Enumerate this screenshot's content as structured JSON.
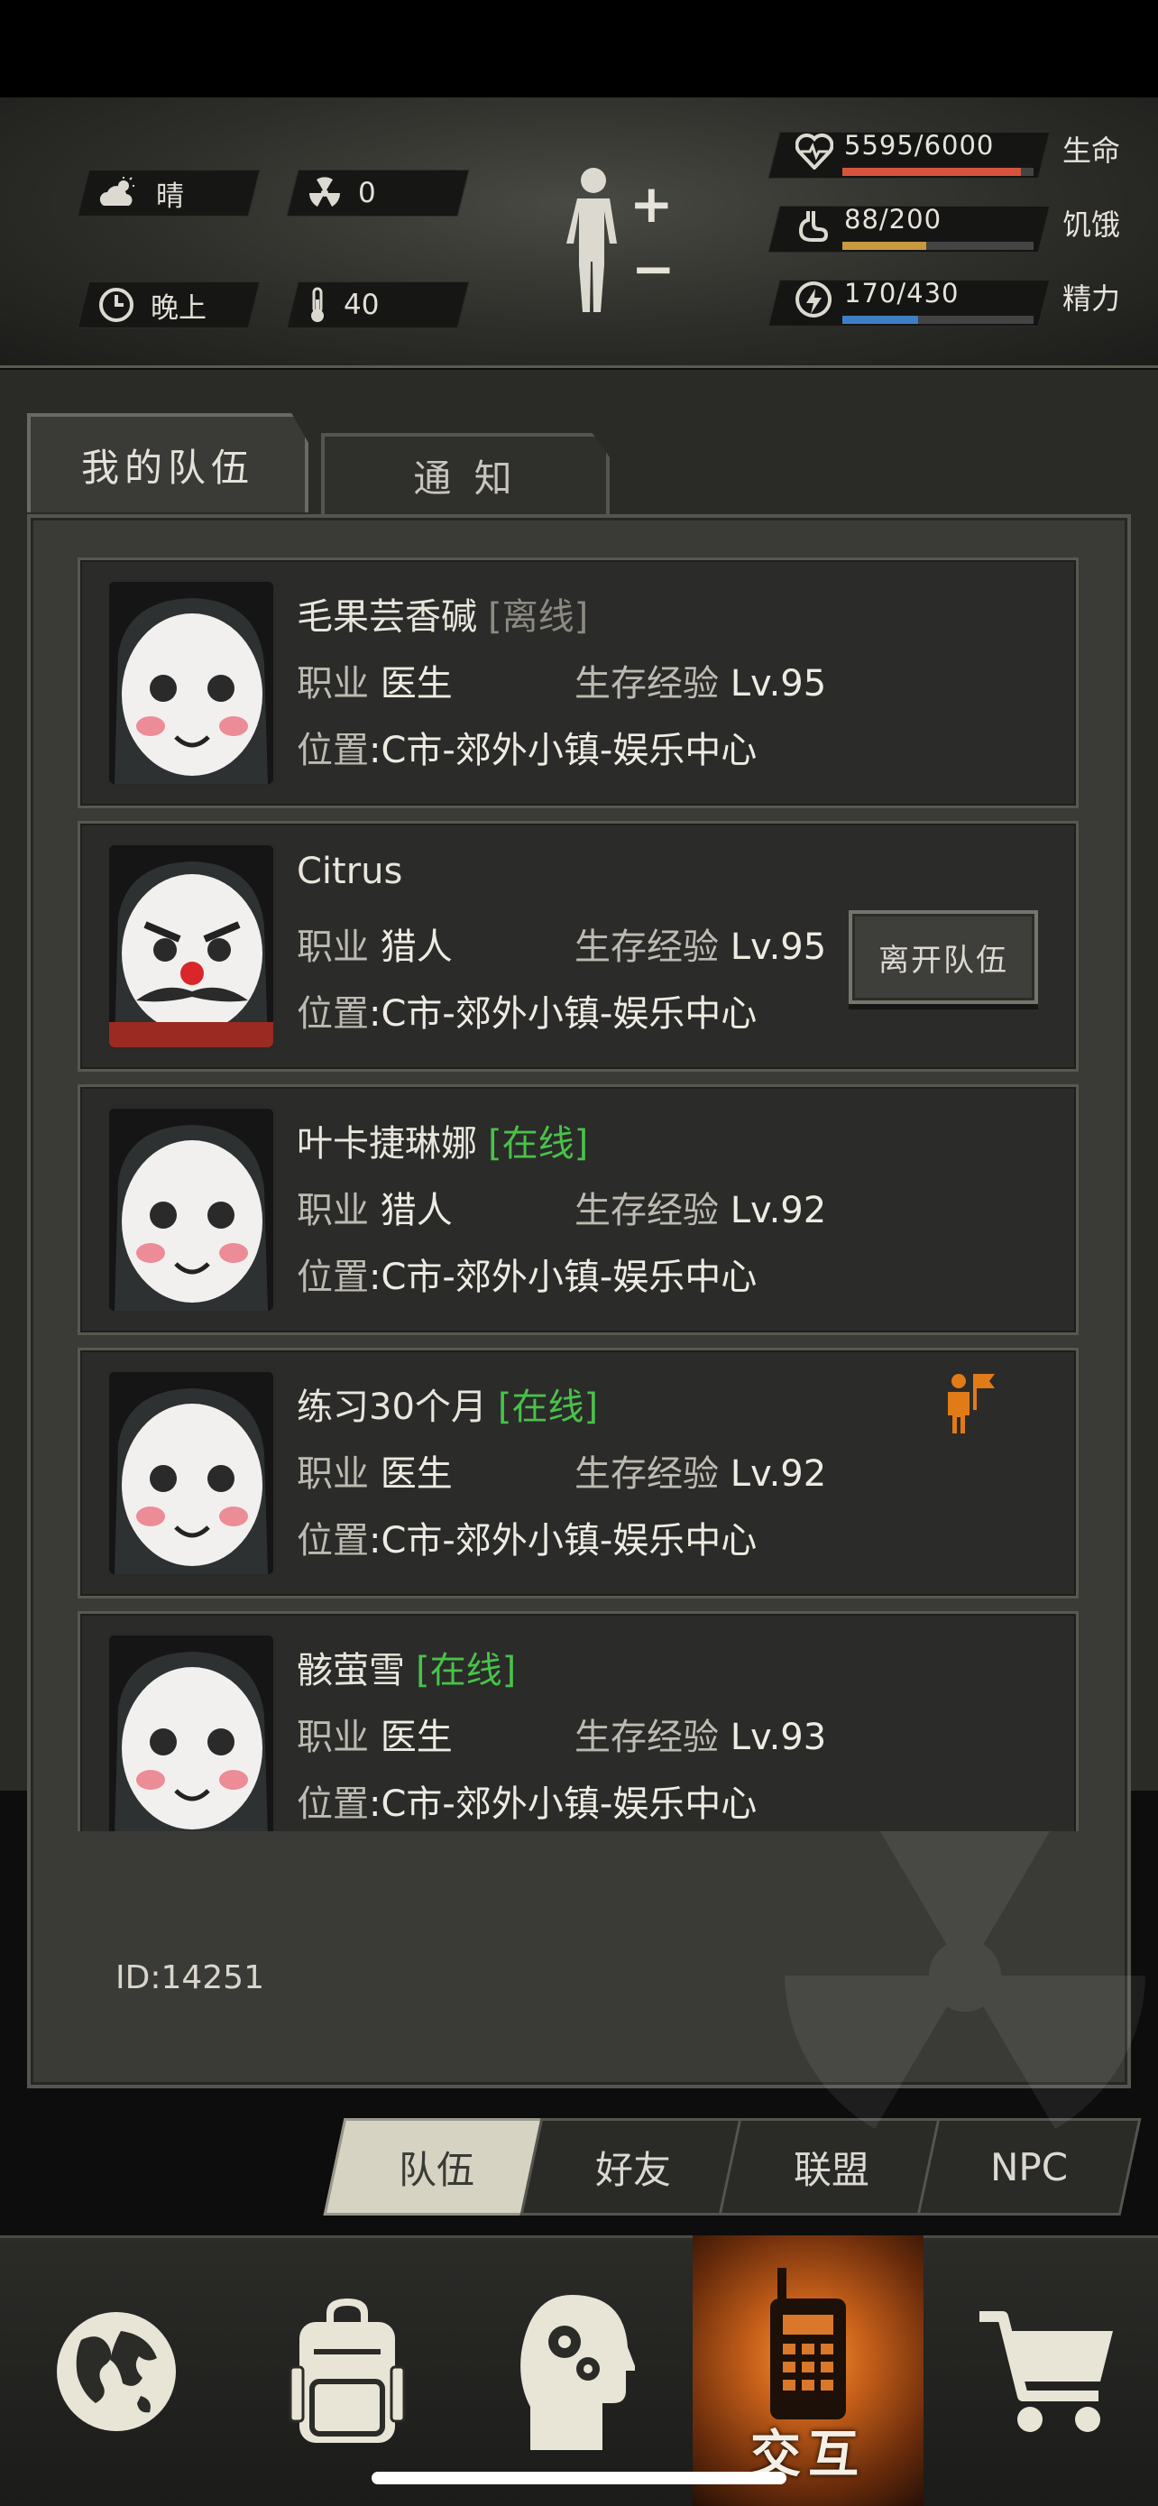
{
  "status": {
    "weather": "晴",
    "radiation": "0",
    "time_of_day": "晚上",
    "temperature": "40"
  },
  "vitals": [
    {
      "value": "5595/6000",
      "label": "生命",
      "fraction": 0.9325,
      "color": "#d6543e",
      "icon": "heart-icon"
    },
    {
      "value": "88/200",
      "label": "饥饿",
      "fraction": 0.44,
      "color": "#c79a3e",
      "icon": "stomach-icon"
    },
    {
      "value": "170/430",
      "label": "精力",
      "fraction": 0.395,
      "color": "#3f7fc4",
      "icon": "energy-icon"
    }
  ],
  "tabs": {
    "team": "我的队伍",
    "notice": "通 知"
  },
  "common": {
    "job_label": "职业",
    "exp_label": "生存经验",
    "location_label": "位置"
  },
  "members": [
    {
      "name": "毛果芸香碱",
      "status": "[离线]",
      "status_color": "#8c8a82",
      "job": "医生",
      "level": "Lv.95",
      "location": ":C市-郊外小镇-娱乐中心",
      "avatar": "mime-avatar"
    },
    {
      "name": "Citrus",
      "status": "",
      "status_color": "#8c8a82",
      "job": "猎人",
      "level": "Lv.95",
      "location": ":C市-郊外小镇-娱乐中心",
      "avatar": "clown-mustache-avatar"
    },
    {
      "name": "叶卡捷琳娜",
      "status": "[在线]",
      "status_color": "#49c24a",
      "job": "猎人",
      "level": "Lv.92",
      "location": ":C市-郊外小镇-娱乐中心",
      "avatar": "mime-avatar"
    },
    {
      "name": "练习30个月",
      "status": "[在线]",
      "status_color": "#49c24a",
      "job": "医生",
      "level": "Lv.92",
      "location": ":C市-郊外小镇-娱乐中心",
      "avatar": "mime-avatar"
    },
    {
      "name": "骸萤雪",
      "status": "[在线]",
      "status_color": "#49c24a",
      "job": "医生",
      "level": "Lv.93",
      "location": ":C市-郊外小镇-娱乐中心",
      "avatar": "mime-avatar"
    }
  ],
  "leave_button": "离开队伍",
  "player_id": "ID:14251",
  "subtabs": [
    "队伍",
    "好友",
    "联盟",
    "NPC"
  ],
  "nav": {
    "interaction_label": "交互"
  }
}
